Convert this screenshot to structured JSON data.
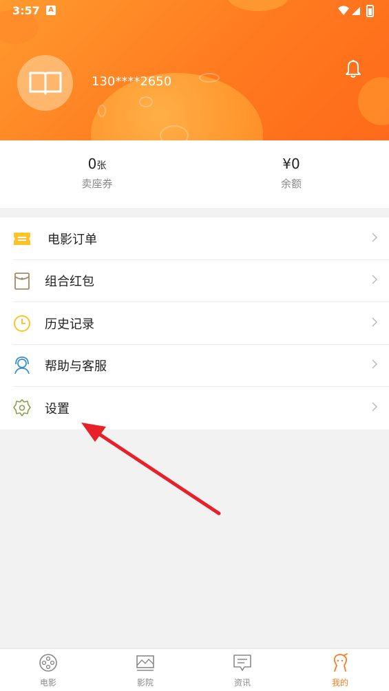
{
  "status_bar": {
    "time": "3:57",
    "notification_badge": "A"
  },
  "profile": {
    "phone": "130****2650",
    "avatar_icon": "book-icon",
    "bell_icon": "bell-icon"
  },
  "stats": [
    {
      "value": "0",
      "unit": "张",
      "label": "卖座券"
    },
    {
      "value": "¥0",
      "unit": "",
      "label": "余额"
    }
  ],
  "menu": [
    {
      "label": "电影订单",
      "icon": "ticket-icon"
    },
    {
      "label": "组合红包",
      "icon": "envelope-icon"
    },
    {
      "label": "历史记录",
      "icon": "clock-icon"
    },
    {
      "label": "帮助与客服",
      "icon": "headset-icon"
    },
    {
      "label": "设置",
      "icon": "gear-icon"
    }
  ],
  "tabs": [
    {
      "label": "电影",
      "icon": "film-reel-icon",
      "active": false
    },
    {
      "label": "影院",
      "icon": "cinema-icon",
      "active": false
    },
    {
      "label": "资讯",
      "icon": "news-icon",
      "active": false
    },
    {
      "label": "我的",
      "icon": "profile-icon",
      "active": true
    }
  ],
  "colors": {
    "brand_orange": "#ff7a1f",
    "annotation_red": "#e8202a"
  }
}
